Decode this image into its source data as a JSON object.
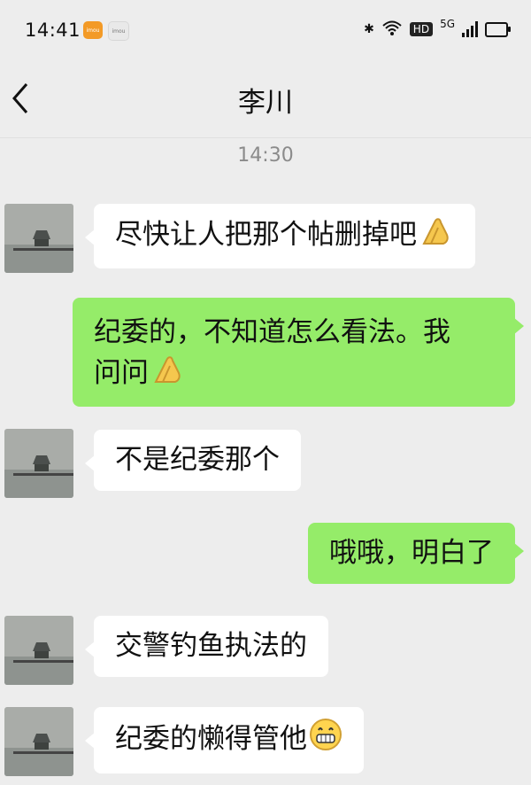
{
  "status_bar": {
    "time": "14:41",
    "app_badges": [
      "imou",
      "imou"
    ],
    "hd_label": "HD",
    "network": "5G"
  },
  "chat": {
    "title": "李川",
    "timestamp": "14:30"
  },
  "messages": [
    {
      "side": "left",
      "text": "尽快让人把那个帖删掉吧",
      "emoji": "pray-icon"
    },
    {
      "side": "right",
      "text_line1": "纪委的，不知道怎么看法。我",
      "text_line2": "问问",
      "emoji": "pray-icon"
    },
    {
      "side": "left",
      "text": "不是纪委那个"
    },
    {
      "side": "right",
      "text": "哦哦，明白了"
    },
    {
      "side": "left",
      "text": "交警钓鱼执法的"
    },
    {
      "side": "left",
      "text": "纪委的懒得管他",
      "emoji": "grin-icon"
    }
  ],
  "colors": {
    "background": "#ededed",
    "bubble_left": "#ffffff",
    "bubble_right": "#95ec69",
    "timestamp": "#8b8b8b"
  }
}
